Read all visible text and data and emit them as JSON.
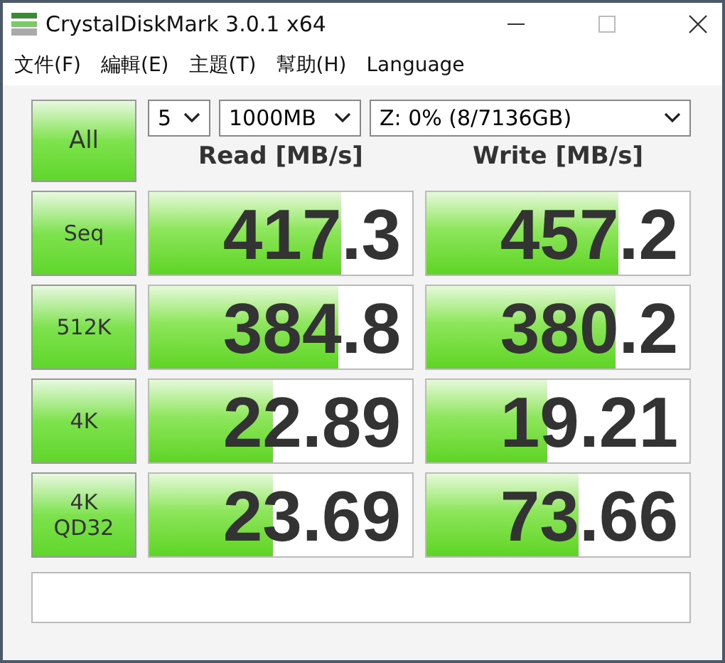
{
  "window": {
    "title": "CrystalDiskMark 3.0.1 x64"
  },
  "menu": [
    "文件(F)",
    "編輯(E)",
    "主題(T)",
    "幫助(H)",
    "Language"
  ],
  "all_button": "All",
  "selects": [
    {
      "value": "5"
    },
    {
      "value": "1000MB"
    },
    {
      "value": "Z: 0% (8/7136GB)"
    }
  ],
  "columns": [
    "Read [MB/s]",
    "Write [MB/s]"
  ],
  "rows": [
    {
      "label": [
        "Seq"
      ],
      "read": {
        "value": "417.3",
        "level": 0.73
      },
      "write": {
        "value": "457.2",
        "level": 0.73
      }
    },
    {
      "label": [
        "512K"
      ],
      "read": {
        "value": "384.8",
        "level": 0.72
      },
      "write": {
        "value": "380.2",
        "level": 0.72
      }
    },
    {
      "label": [
        "4K"
      ],
      "read": {
        "value": "22.89",
        "level": 0.47
      },
      "write": {
        "value": "19.21",
        "level": 0.46
      }
    },
    {
      "label": [
        "4K",
        "QD32"
      ],
      "read": {
        "value": "23.69",
        "level": 0.47
      },
      "write": {
        "value": "73.66",
        "level": 0.58
      }
    }
  ]
}
